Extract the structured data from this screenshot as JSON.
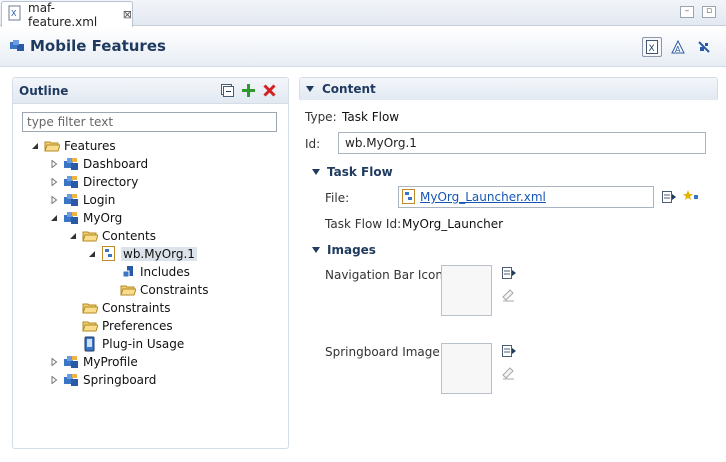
{
  "editor_tab": {
    "label": "maf-feature.xml",
    "close": "⊠"
  },
  "form": {
    "title": "Mobile Features"
  },
  "outline": {
    "title": "Outline",
    "filter_placeholder": "type filter text",
    "tree": [
      {
        "label": "Features",
        "twisty": "expanded",
        "icon": "folder-open-icon"
      },
      {
        "label": "Dashboard",
        "twisty": "collapsed",
        "icon": "feature-icon"
      },
      {
        "label": "Directory",
        "twisty": "collapsed",
        "icon": "feature-icon"
      },
      {
        "label": "Login",
        "twisty": "collapsed",
        "icon": "feature-icon"
      },
      {
        "label": "MyOrg",
        "twisty": "expanded",
        "icon": "feature-icon"
      },
      {
        "label": "Contents",
        "twisty": "expanded",
        "icon": "folder-open-icon"
      },
      {
        "label": "wb.MyOrg.1",
        "twisty": "expanded",
        "icon": "taskflow-icon",
        "selected": true
      },
      {
        "label": "Includes",
        "twisty": "none",
        "icon": "includes-icon"
      },
      {
        "label": "Constraints",
        "twisty": "none",
        "icon": "folder-open-icon"
      },
      {
        "label": "Constraints",
        "twisty": "none",
        "icon": "folder-open-icon"
      },
      {
        "label": "Preferences",
        "twisty": "none",
        "icon": "folder-open-icon"
      },
      {
        "label": "Plug-in Usage",
        "twisty": "none",
        "icon": "plugin-icon"
      },
      {
        "label": "MyProfile",
        "twisty": "collapsed",
        "icon": "feature-icon"
      },
      {
        "label": "Springboard",
        "twisty": "collapsed",
        "icon": "feature-icon"
      }
    ]
  },
  "content": {
    "title": "Content",
    "type_label": "Type:",
    "type_value": "Task Flow",
    "id_label": "Id:",
    "id_value": "wb.MyOrg.1",
    "task_flow": {
      "title": "Task Flow",
      "file_label": "File:",
      "file_value": "MyOrg_Launcher.xml",
      "taskflow_id_label": "Task Flow Id:",
      "taskflow_id_value": "MyOrg_Launcher"
    },
    "images": {
      "title": "Images",
      "nav_bar_label": "Navigation Bar Icon:",
      "springboard_label": "Springboard Image:"
    }
  },
  "colors": {
    "header_text": "#1f3a5f",
    "link": "#1556b5",
    "delete_red": "#d42020",
    "add_green": "#2e9a2e"
  }
}
